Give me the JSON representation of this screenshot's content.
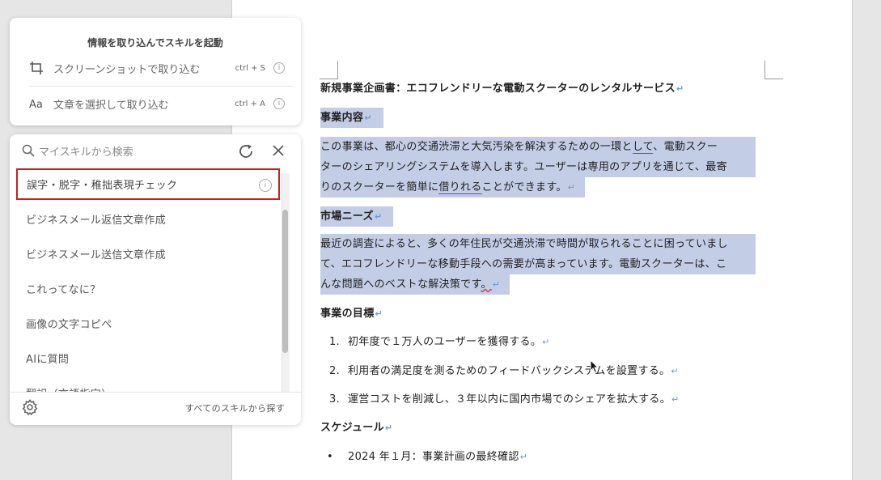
{
  "panel_top": {
    "title": "情報を取り込んでスキルを起動",
    "rows": [
      {
        "label": "スクリーンショットで取り込む",
        "shortcut": "ctrl + S",
        "icon": "crop-icon"
      },
      {
        "label": "文章を選択して取り込む",
        "shortcut": "ctrl + A",
        "icon": "text-select-icon"
      }
    ],
    "info_glyph": "i"
  },
  "skills": {
    "search_placeholder": "マイスキルから検索",
    "items": [
      "誤字・脱字・稚拙表現チェック",
      "ビジネスメール返信文章作成",
      "ビジネスメール送信文章作成",
      "これってなに？",
      "画像の文字コピペ",
      "AIに質問",
      "翻訳（言語指定）"
    ],
    "all_skills_link": "すべてのスキルから探す"
  },
  "document": {
    "title": "新規事業企画書：エコフレンドリーな電動スクーターのレンタルサービス",
    "h_content": "事業内容",
    "content_lines": [
      "この事業は、都心の交通渋滞と大気汚染を解決するための一環と",
      "して",
      "、電動スクー",
      "ターのシェアリングシステムを導入します。ユーザーは専用のアプリを通じて、最寄",
      "りのスクーターを簡単に",
      "借りれる",
      "ことができます。"
    ],
    "h_needs": "市場ニーズ",
    "needs_lines": [
      "最近の調査によると、多くの年住民が交通渋滞で時間が取られることに困っていまし",
      "て、エコフレンドリーな移動手段への需要が高まっています。電動スクーターは、こ",
      "んな問題へのベストな解決策です",
      "。"
    ],
    "h_goals": "事業の目標",
    "goals": [
      {
        "num": "1.",
        "text": "初年度で１万人のユーザーを獲得する。"
      },
      {
        "num": "2.",
        "text": "利用者の満足度を測るためのフィードバックシステムを設置する。"
      },
      {
        "num": "3.",
        "text": "運営コストを削減し、３年以内に国内市場でのシェアを拡大する。"
      }
    ],
    "h_schedule": "スケジュール",
    "schedule": [
      {
        "bullet": "•",
        "text": "2024 年１月：事業計画の最終確認"
      }
    ],
    "para_mark": "↵"
  },
  "colors": {
    "selection": "#c3cde6",
    "active_border": "#cc1f1f",
    "para_mark": "#6b9bd7"
  }
}
